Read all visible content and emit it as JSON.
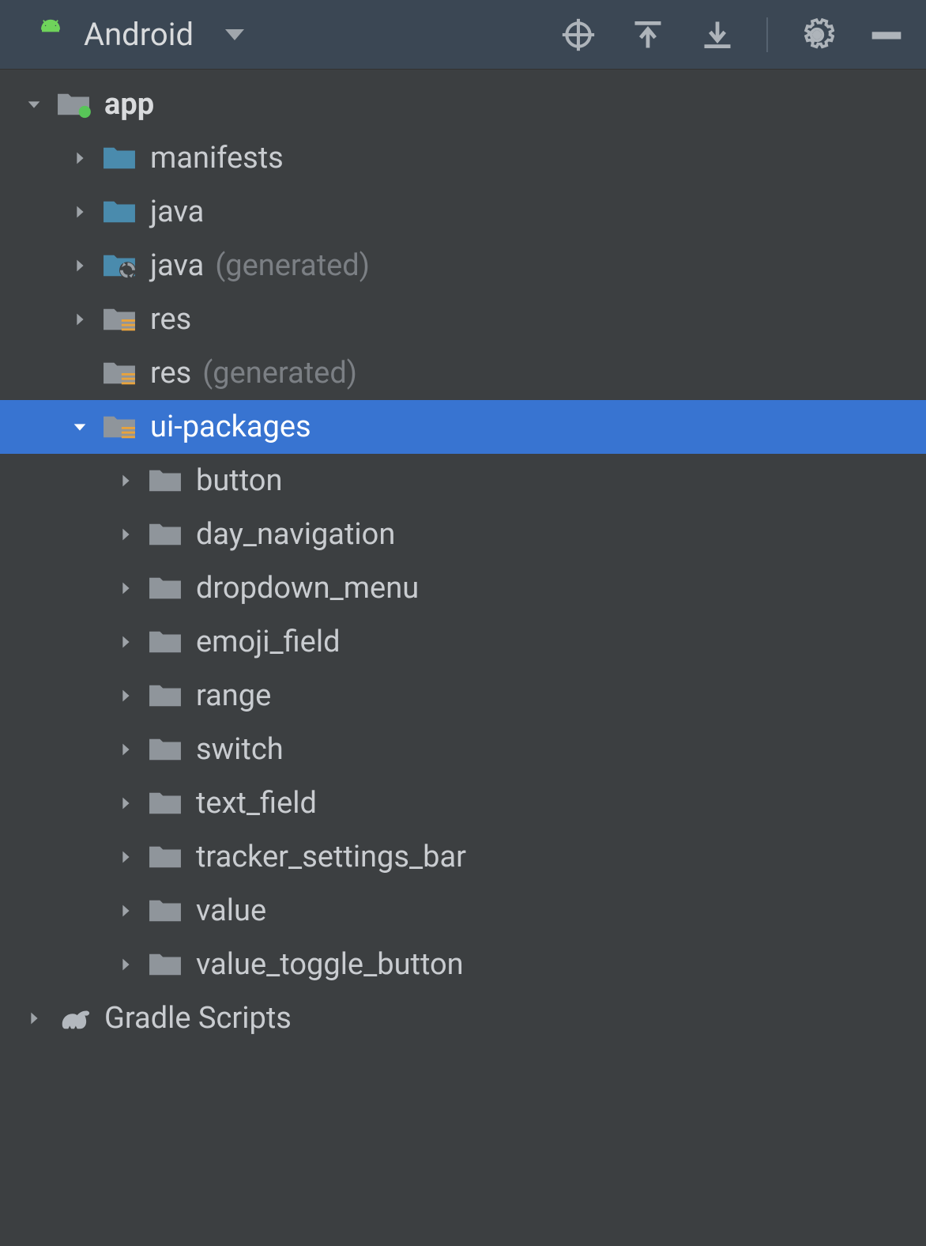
{
  "toolbar": {
    "view_label": "Android"
  },
  "tree": [
    {
      "depth": 0,
      "arrow": "down",
      "icon": "module",
      "label": "app",
      "bold": true
    },
    {
      "depth": 1,
      "arrow": "right",
      "icon": "folder-blue",
      "label": "manifests"
    },
    {
      "depth": 1,
      "arrow": "right",
      "icon": "folder-blue",
      "label": "java"
    },
    {
      "depth": 1,
      "arrow": "right",
      "icon": "folder-gen",
      "label": "java",
      "suffix": "(generated)"
    },
    {
      "depth": 1,
      "arrow": "right",
      "icon": "folder-res",
      "label": "res"
    },
    {
      "depth": 1,
      "arrow": "none",
      "icon": "folder-res",
      "label": "res",
      "suffix": "(generated)"
    },
    {
      "depth": 1,
      "arrow": "down",
      "icon": "folder-res",
      "label": "ui-packages",
      "selected": true
    },
    {
      "depth": 2,
      "arrow": "right",
      "icon": "folder-gray",
      "label": "button"
    },
    {
      "depth": 2,
      "arrow": "right",
      "icon": "folder-gray",
      "label": "day_navigation"
    },
    {
      "depth": 2,
      "arrow": "right",
      "icon": "folder-gray",
      "label": "dropdown_menu"
    },
    {
      "depth": 2,
      "arrow": "right",
      "icon": "folder-gray",
      "label": "emoji_field"
    },
    {
      "depth": 2,
      "arrow": "right",
      "icon": "folder-gray",
      "label": "range"
    },
    {
      "depth": 2,
      "arrow": "right",
      "icon": "folder-gray",
      "label": "switch"
    },
    {
      "depth": 2,
      "arrow": "right",
      "icon": "folder-gray",
      "label": "text_field"
    },
    {
      "depth": 2,
      "arrow": "right",
      "icon": "folder-gray",
      "label": "tracker_settings_bar"
    },
    {
      "depth": 2,
      "arrow": "right",
      "icon": "folder-gray",
      "label": "value"
    },
    {
      "depth": 2,
      "arrow": "right",
      "icon": "folder-gray",
      "label": "value_toggle_button"
    },
    {
      "depth": 0,
      "arrow": "right",
      "icon": "gradle",
      "label": "Gradle Scripts"
    }
  ],
  "colors": {
    "bg": "#3c3f41",
    "toolbar": "#3b4754",
    "selected": "#3874d1",
    "folder_blue": "#4a8bad",
    "folder_gray": "#8f959b",
    "android_green": "#6fd35b"
  }
}
